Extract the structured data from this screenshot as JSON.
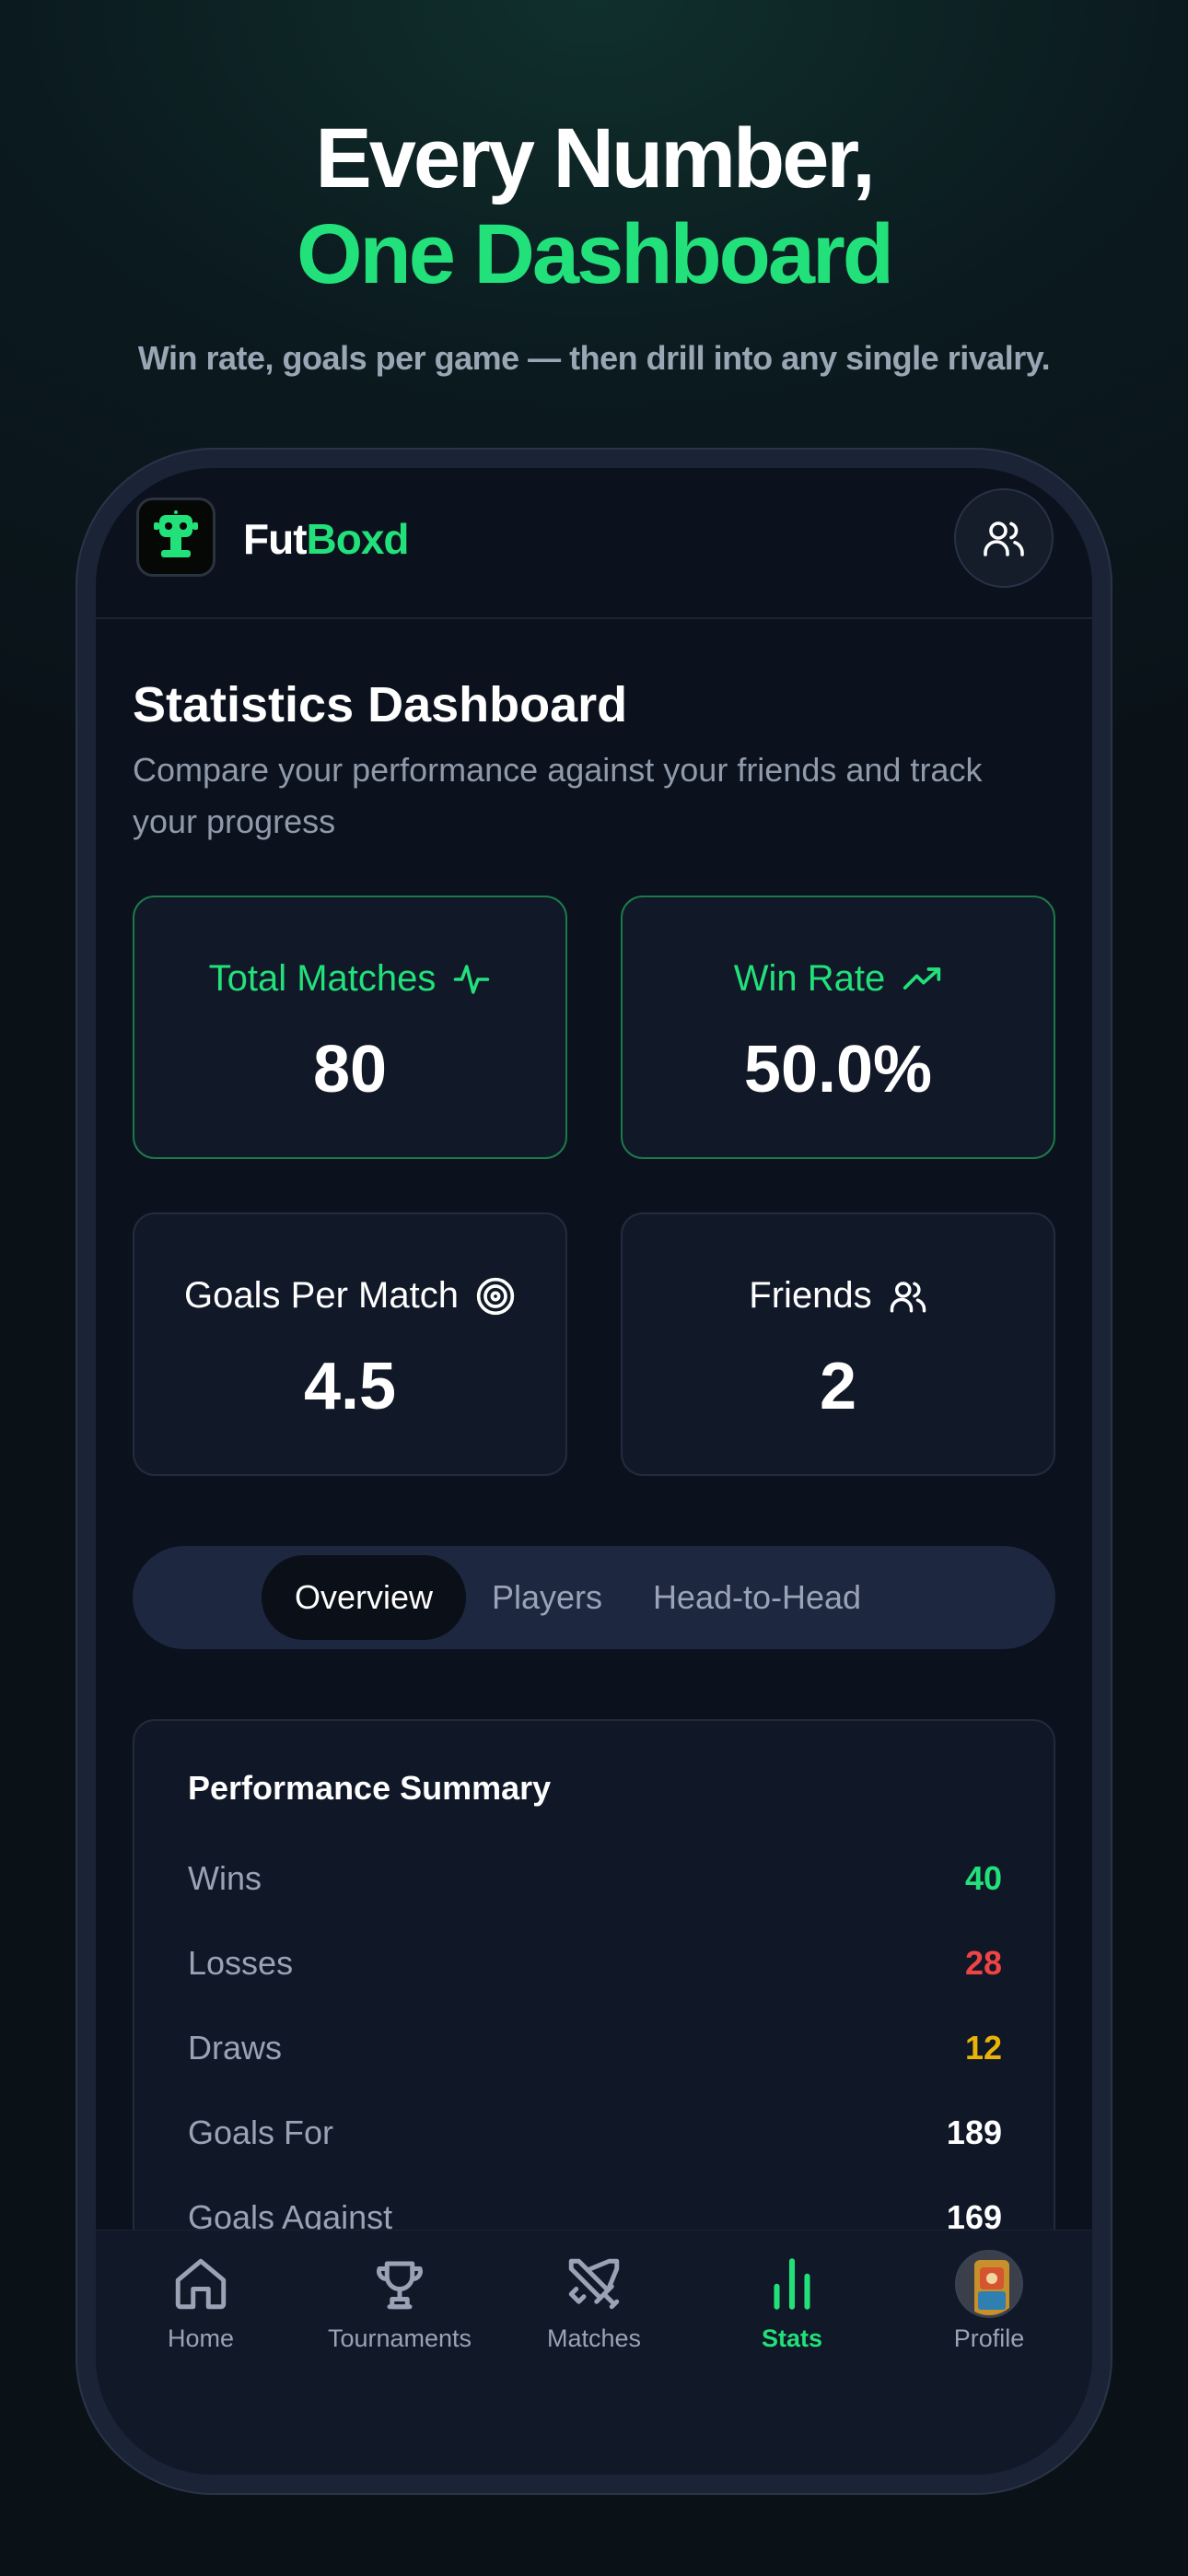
{
  "hero": {
    "line1": "Every Number,",
    "line2": "One Dashboard",
    "tagline": "Win rate, goals per game — then drill into any single rivalry."
  },
  "app": {
    "name_part1": "Fut",
    "name_part2": "Boxd"
  },
  "page": {
    "title": "Statistics Dashboard",
    "subtitle": "Compare your performance against your friends and track your progress"
  },
  "stats": [
    {
      "label": "Total Matches",
      "value": "80",
      "icon": "activity-icon"
    },
    {
      "label": "Win Rate",
      "value": "50.0%",
      "icon": "trending-up-icon"
    },
    {
      "label": "Goals Per Match",
      "value": "4.5",
      "icon": "target-icon"
    },
    {
      "label": "Friends",
      "value": "2",
      "icon": "users-icon"
    }
  ],
  "tabs": [
    {
      "label": "Overview",
      "active": true
    },
    {
      "label": "Players",
      "active": false
    },
    {
      "label": "Head-to-Head",
      "active": false
    }
  ],
  "summary": {
    "title": "Performance Summary",
    "rows": [
      {
        "label": "Wins",
        "value": "40",
        "color": "#22e07a"
      },
      {
        "label": "Losses",
        "value": "28",
        "color": "#ef4444"
      },
      {
        "label": "Draws",
        "value": "12",
        "color": "#eab308"
      },
      {
        "label": "Goals For",
        "value": "189",
        "color": "#ffffff"
      },
      {
        "label": "Goals Against",
        "value": "169",
        "color": "#ffffff"
      }
    ]
  },
  "nav": [
    {
      "label": "Home",
      "icon": "home-icon"
    },
    {
      "label": "Tournaments",
      "icon": "trophy-icon"
    },
    {
      "label": "Matches",
      "icon": "swords-icon"
    },
    {
      "label": "Stats",
      "icon": "bar-chart-icon",
      "active": true
    },
    {
      "label": "Profile",
      "icon": "avatar"
    }
  ],
  "colors": {
    "accent": "#22e07a",
    "background": "#0b111d"
  }
}
